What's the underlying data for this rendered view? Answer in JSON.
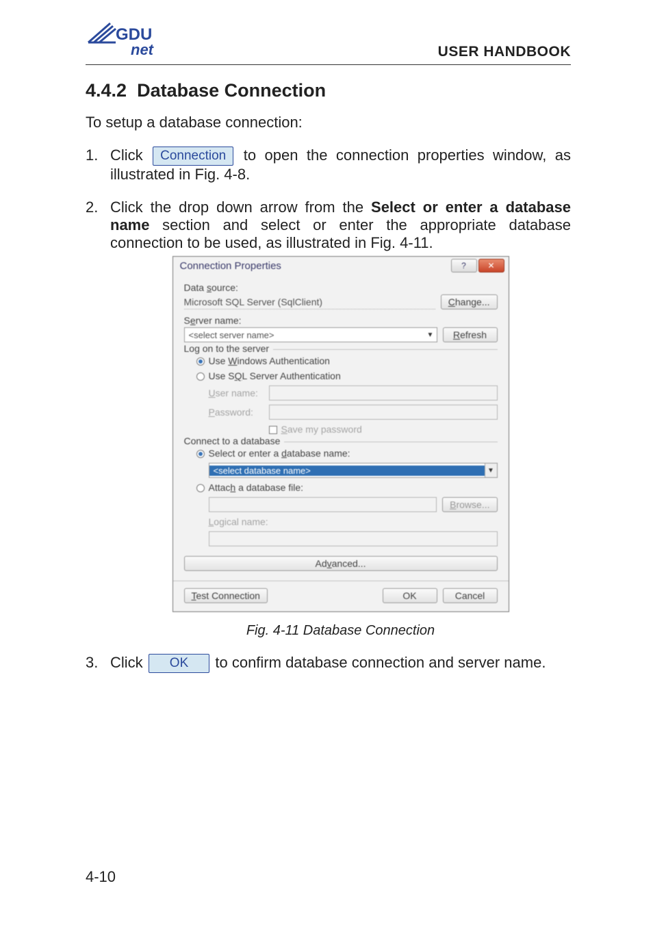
{
  "header": {
    "logo_top": "GDU",
    "logo_bottom": "net",
    "title": "USER HANDBOOK"
  },
  "section": {
    "number": "4.4.2",
    "title": "Database Connection"
  },
  "intro": "To setup a database connection:",
  "steps": {
    "s1_a": "Click",
    "s1_btn": "Connection",
    "s1_b": "to open the connection properties window, as illustrated in Fig. 4-8.",
    "s2_a": "Click the drop down arrow from the ",
    "s2_bold": "Select or enter a database name",
    "s2_b": " section and select or enter the appropriate database connection to be used, as illustrated in Fig. 4-11.",
    "s3_a": "Click",
    "s3_btn": "OK",
    "s3_b": "to confirm database connection and server name."
  },
  "dialog": {
    "title": "Connection Properties",
    "close_glyph": "✕",
    "help_glyph": "?",
    "data_source_label": "Data source:",
    "data_source_value": "Microsoft SQL Server (SqlClient)",
    "change_btn": "Change...",
    "server_name_label": "Server name:",
    "server_name_placeholder": "<select server name>",
    "refresh_btn": "Refresh",
    "logon_legend": "Log on to the server",
    "auth_win": "Use Windows Authentication",
    "auth_sql": "Use SQL Server Authentication",
    "user_name_label": "User name:",
    "password_label": "Password:",
    "save_pwd": "Save my password",
    "connect_legend": "Connect to a database",
    "select_db_label": "Select or enter a database name:",
    "select_db_value": "<select database name>",
    "attach_label": "Attach a database file:",
    "browse_btn": "Browse...",
    "logical_label": "Logical name:",
    "advanced_btn": "Advanced...",
    "test_btn": "Test Connection",
    "ok_btn": "OK",
    "cancel_btn": "Cancel"
  },
  "figure_caption": "Fig. 4-11  Database Connection",
  "page_number": "4-10"
}
